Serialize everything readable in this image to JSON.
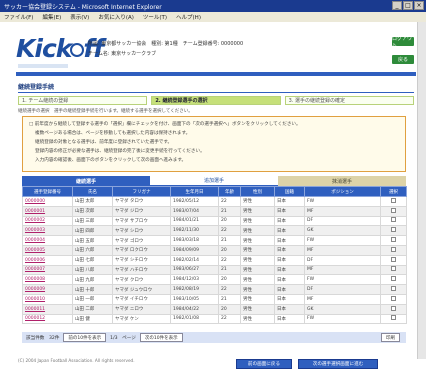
{
  "window": {
    "title": "サッカー協会登録システム - Microsoft Internet Explorer",
    "minimize": "_",
    "maximize": "□",
    "close": "×"
  },
  "menu": [
    "ファイル(F)",
    "編集(E)",
    "表示(V)",
    "お気に入り(A)",
    "ツール(T)",
    "ヘルプ(H)"
  ],
  "header": {
    "logo_text_left": "Kick",
    "logo_text_right": "ff",
    "line1": "所属: 東京都サッカー協会　種別: 第1種　チーム登録番号: 0000000",
    "line2": "チーム名: 東京サッカークラブ",
    "logout": "ログアウト",
    "menu_button": "戻る"
  },
  "page_title": "継続登録手続",
  "steps": [
    {
      "label": "1. チーム継続の登録",
      "active": false
    },
    {
      "label": "2. 継続登録選手の選択",
      "active": true
    },
    {
      "label": "3. 選手の継続登録の確定",
      "active": false
    }
  ],
  "step_note": "継続選手の選択　選手の継続登録手続を行います。継続する選手を選択してください。",
  "notice_lines": [
    "□ 前年度から継続して登録する選手の「選択」欄にチェックを付け、画面下の「次の選手選択へ」ボタンをクリックしてください。",
    "　 複数ページある場合は、ページを移動しても選択した内容は保持されます。",
    "　 継続登録の対象となる選手は、前年度に登録されていた選手です。",
    "　 登録内容の修正が必要な選手は、継続登録の完了後に変更手続を行ってください。",
    "　 入力内容の確認後、画面下のボタンをクリックして次の画面へ進みます。"
  ],
  "tabs": [
    "継続選手",
    "追加選手",
    "抹消選手"
  ],
  "table": {
    "headers": [
      "選手登録番号",
      "氏名",
      "フリガナ",
      "生年月日",
      "年齢",
      "性別",
      "国籍",
      "ポジション",
      "選択"
    ],
    "rows": [
      [
        "0000000",
        "山田 太郎",
        "ヤマダ タロウ",
        "1982/05/12",
        "22",
        "男性",
        "日本",
        "FW"
      ],
      [
        "0000001",
        "山田 次郎",
        "ヤマダ ジロウ",
        "1983/07/04",
        "21",
        "男性",
        "日本",
        "MF"
      ],
      [
        "0000002",
        "山田 三郎",
        "ヤマダ サブロウ",
        "1984/01/21",
        "20",
        "男性",
        "日本",
        "DF"
      ],
      [
        "0000003",
        "山田 四郎",
        "ヤマダ シロウ",
        "1982/11/30",
        "22",
        "男性",
        "日本",
        "GK"
      ],
      [
        "0000004",
        "山田 五郎",
        "ヤマダ ゴロウ",
        "1983/03/18",
        "21",
        "男性",
        "日本",
        "FW"
      ],
      [
        "0000005",
        "山田 六郎",
        "ヤマダ ロクロウ",
        "1984/09/09",
        "20",
        "男性",
        "日本",
        "MF"
      ],
      [
        "0000006",
        "山田 七郎",
        "ヤマダ シチロウ",
        "1982/02/14",
        "22",
        "男性",
        "日本",
        "DF"
      ],
      [
        "0000007",
        "山田 八郎",
        "ヤマダ ハチロウ",
        "1983/06/27",
        "21",
        "男性",
        "日本",
        "MF"
      ],
      [
        "0000008",
        "山田 九郎",
        "ヤマダ クロウ",
        "1984/12/03",
        "20",
        "男性",
        "日本",
        "FW"
      ],
      [
        "0000009",
        "山田 十郎",
        "ヤマダ ジュウロウ",
        "1982/08/19",
        "22",
        "男性",
        "日本",
        "DF"
      ],
      [
        "0000010",
        "山田 一郎",
        "ヤマダ イチロウ",
        "1983/10/05",
        "21",
        "男性",
        "日本",
        "MF"
      ],
      [
        "0000011",
        "山田 二郎",
        "ヤマダ ニロウ",
        "1984/04/22",
        "20",
        "男性",
        "日本",
        "GK"
      ],
      [
        "0000012",
        "山田 健",
        "ヤマダ ケン",
        "1982/01/08",
        "22",
        "男性",
        "日本",
        "FW"
      ]
    ]
  },
  "pager": {
    "total": "該当件数　32件",
    "prev": "前の10件を表示",
    "page": "1/3　ページ",
    "next": "次の10件を表示",
    "print": "印刷"
  },
  "footer": "(C) 2004 Japan Football Association. All rights reserved.",
  "bottom_buttons": {
    "back": "前の画面に戻る",
    "next": "次の選手選択画面に進む"
  }
}
